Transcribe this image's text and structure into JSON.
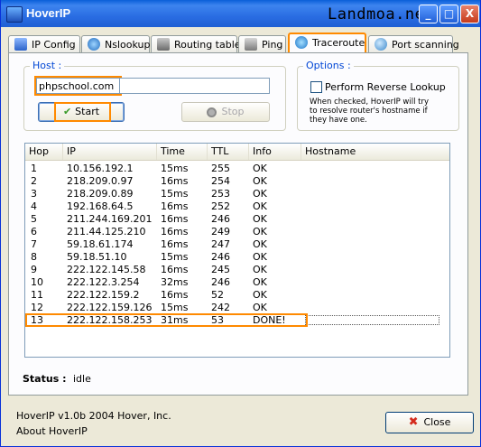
{
  "window": {
    "title": "HoverIP",
    "watermark": "Landmoa.net",
    "controls": [
      "_",
      "□",
      "X"
    ]
  },
  "tabs": [
    {
      "label": "IP Config",
      "icon": "ip-config-icon",
      "active": false
    },
    {
      "label": "Nslookup",
      "icon": "globe-icon",
      "active": false
    },
    {
      "label": "Routing table",
      "icon": "network-icon",
      "active": false
    },
    {
      "label": "Ping",
      "icon": "ping-icon",
      "active": false
    },
    {
      "label": "Traceroute",
      "icon": "globe-route-icon",
      "active": true
    },
    {
      "label": "Port scanning",
      "icon": "magnifier-icon",
      "active": false
    }
  ],
  "host": {
    "legend": "Host :",
    "value": "phpschool.com",
    "start_label": "Start",
    "stop_label": "Stop"
  },
  "options": {
    "legend": "Options :",
    "reverse_label": "Perform Reverse Lookup",
    "reverse_checked": false,
    "description_lines": [
      "When checked, HoverIP will try",
      "to resolve router's hostname if",
      "they have one."
    ]
  },
  "table": {
    "columns": [
      "Hop",
      "IP",
      "Time",
      "TTL",
      "Info",
      "Hostname"
    ],
    "rows": [
      [
        "1",
        "10.156.192.1",
        "15ms",
        "255",
        "OK",
        ""
      ],
      [
        "2",
        "218.209.0.97",
        "16ms",
        "254",
        "OK",
        ""
      ],
      [
        "3",
        "218.209.0.89",
        "15ms",
        "253",
        "OK",
        ""
      ],
      [
        "4",
        "192.168.64.5",
        "16ms",
        "252",
        "OK",
        ""
      ],
      [
        "5",
        "211.244.169.201",
        "16ms",
        "246",
        "OK",
        ""
      ],
      [
        "6",
        "211.44.125.210",
        "16ms",
        "249",
        "OK",
        ""
      ],
      [
        "7",
        "59.18.61.174",
        "16ms",
        "247",
        "OK",
        ""
      ],
      [
        "8",
        "59.18.51.10",
        "15ms",
        "246",
        "OK",
        ""
      ],
      [
        "9",
        "222.122.145.58",
        "16ms",
        "245",
        "OK",
        ""
      ],
      [
        "10",
        "222.122.3.254",
        "32ms",
        "246",
        "OK",
        ""
      ],
      [
        "11",
        "222.122.159.2",
        "16ms",
        "52",
        "OK",
        ""
      ],
      [
        "12",
        "222.122.159.126",
        "15ms",
        "242",
        "OK",
        ""
      ],
      [
        "13",
        "222.122.158.253",
        "31ms",
        "53",
        "DONE!",
        ""
      ]
    ]
  },
  "status": {
    "label": "Status :",
    "value": "idle"
  },
  "footer": {
    "copyright": "HoverIP v1.0b 2004 Hover, Inc.",
    "about": "About HoverIP",
    "close_label": "Close"
  },
  "colors": {
    "highlight": "#ff8a00",
    "titlebar": "#0a5fd8",
    "selection": "#ff8a00"
  }
}
